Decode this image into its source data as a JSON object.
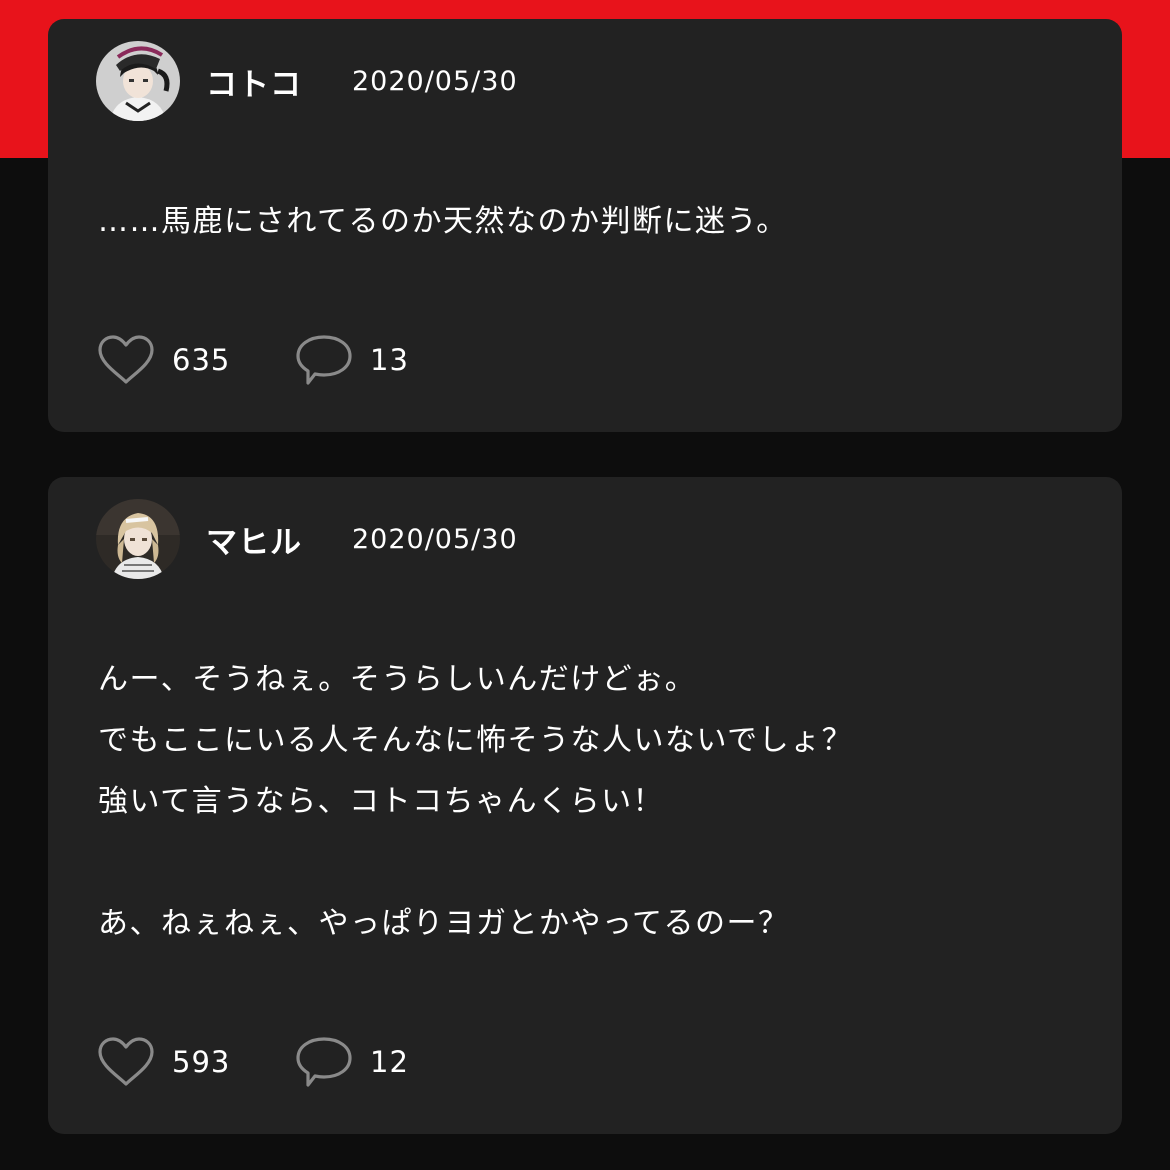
{
  "colors": {
    "banner": "#e8131b",
    "page_background": "#0d0d0d",
    "card_background": "#222222",
    "icon_stroke": "#8a8a8a",
    "text": "#ffffff"
  },
  "posts": [
    {
      "username": "コトコ",
      "date": "2020/05/30",
      "avatar_icon": "user-avatar-dark-hair-cap",
      "lines": [
        "……馬鹿にされてるのか天然なのか判断に迷う。"
      ],
      "likes": "635",
      "comments": "13",
      "like_icon": "heart-outline-icon",
      "comment_icon": "speech-bubble-icon"
    },
    {
      "username": "マヒル",
      "date": "2020/05/30",
      "avatar_icon": "user-avatar-blonde-hair",
      "lines": [
        "んー、そうねぇ。そうらしいんだけどぉ。",
        "でもここにいる人そんなに怖そうな人いないでしょ？",
        "強いて言うなら、コトコちゃんくらい！",
        "",
        "あ、ねぇねぇ、やっぱりヨガとかやってるのー？"
      ],
      "likes": "593",
      "comments": "12",
      "like_icon": "heart-outline-icon",
      "comment_icon": "speech-bubble-icon"
    }
  ]
}
